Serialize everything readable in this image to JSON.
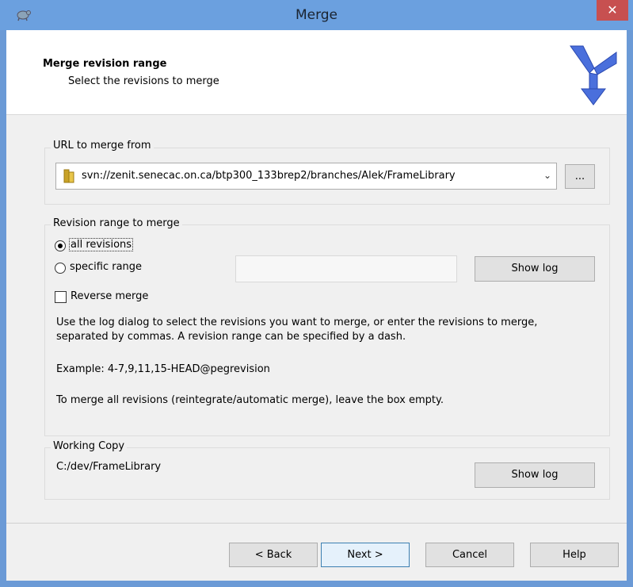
{
  "window": {
    "title": "Merge",
    "close_label": "✕"
  },
  "header": {
    "title": "Merge revision range",
    "subtitle": "Select the revisions to merge"
  },
  "url_group": {
    "label": "URL to merge from",
    "url_value": "svn://zenit.senecac.on.ca/btp300_133brep2/branches/Alek/FrameLibrary",
    "browse_label": "...",
    "dropdown_icon": "chevron-down-icon"
  },
  "revision_group": {
    "label": "Revision range to merge",
    "all_revisions_label": "all revisions",
    "all_revisions_checked": true,
    "specific_range_label": "specific range",
    "range_value": "",
    "show_log_label": "Show log",
    "reverse_merge_label": "Reverse merge",
    "reverse_merge_checked": false,
    "help_text": "Use the log dialog to select the revisions you want to merge, or enter the revisions to merge, separated by commas. A revision range can be specified by a dash.",
    "example_text": "Example: 4-7,9,11,15-HEAD@pegrevision",
    "empty_hint": "To merge all revisions (reintegrate/automatic merge), leave the box empty."
  },
  "working_copy": {
    "label": "Working Copy",
    "path": "C:/dev/FrameLibrary",
    "show_log_label": "Show log"
  },
  "buttons": {
    "back": "< Back",
    "next": "Next >",
    "cancel": "Cancel",
    "help": "Help"
  },
  "colors": {
    "titlebar": "#6ba0df",
    "close": "#c75050",
    "logo": "#3a5bd1"
  }
}
